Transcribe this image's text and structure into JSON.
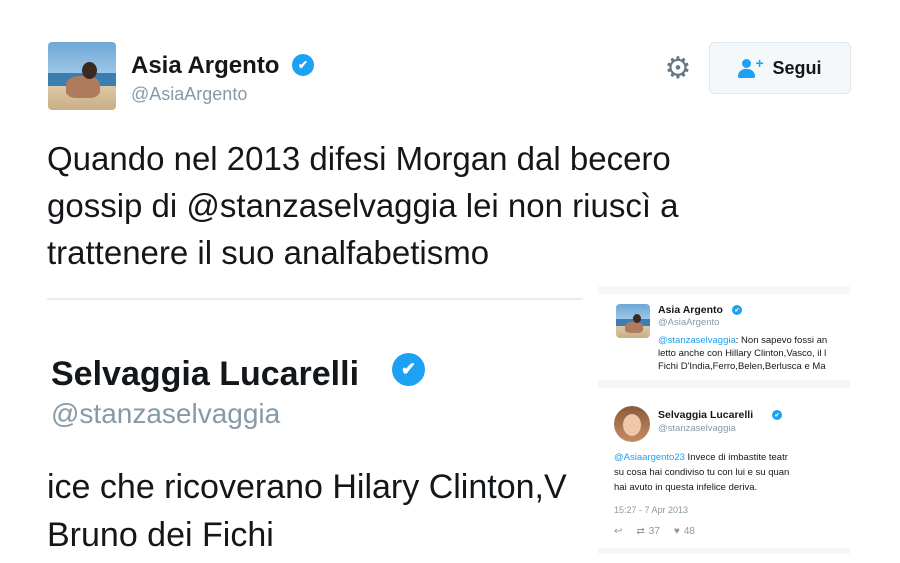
{
  "main_tweet": {
    "author_name": "Asia Argento",
    "handle": "@AsiaArgento",
    "follow_label": "Segui",
    "text_lines": [
      "Quando nel 2013 difesi Morgan dal becero",
      "gossip di @stanzaselvaggia lei non riuscì a",
      "trattenere il suo analfabetismo"
    ]
  },
  "embed_crop": {
    "author_name": "Selvaggia Lucarelli",
    "handle": "@stanzaselvaggia",
    "text_lines": [
      "ice che ricoverano Hilary Clinton,V",
      "Bruno dei Fichi"
    ]
  },
  "embed_screenshot": {
    "tweet1": {
      "author_name": "Asia Argento",
      "handle": "@AsiaArgento",
      "mention": "@stanzaselvaggia",
      "text_lines": [
        ": Non sapevo fossi an",
        "letto anche con Hillary Clinton,Vasco, il l",
        "Fichi D'India,Ferro,Belen,Berlusca e Ma"
      ]
    },
    "tweet2": {
      "author_name": "Selvaggia Lucarelli",
      "handle": "@stanzaselvaggia",
      "mention": "@Asiaargento23",
      "text_lines": [
        " Invece di imbastite teatr",
        "su cosa hai condiviso tu con lui e su quan",
        "hai avuto in questa infelice deriva."
      ],
      "timestamp": "15:27 - 7 Apr 2013",
      "retweets": "37",
      "likes": "48"
    }
  },
  "icons": {
    "verified": "✔",
    "gear": "⚙",
    "reply": "↩",
    "retweet": "⇄",
    "like": "♥"
  },
  "colors": {
    "twitter_blue": "#1da1f2",
    "text": "#14171a",
    "muted": "#8899a6"
  }
}
